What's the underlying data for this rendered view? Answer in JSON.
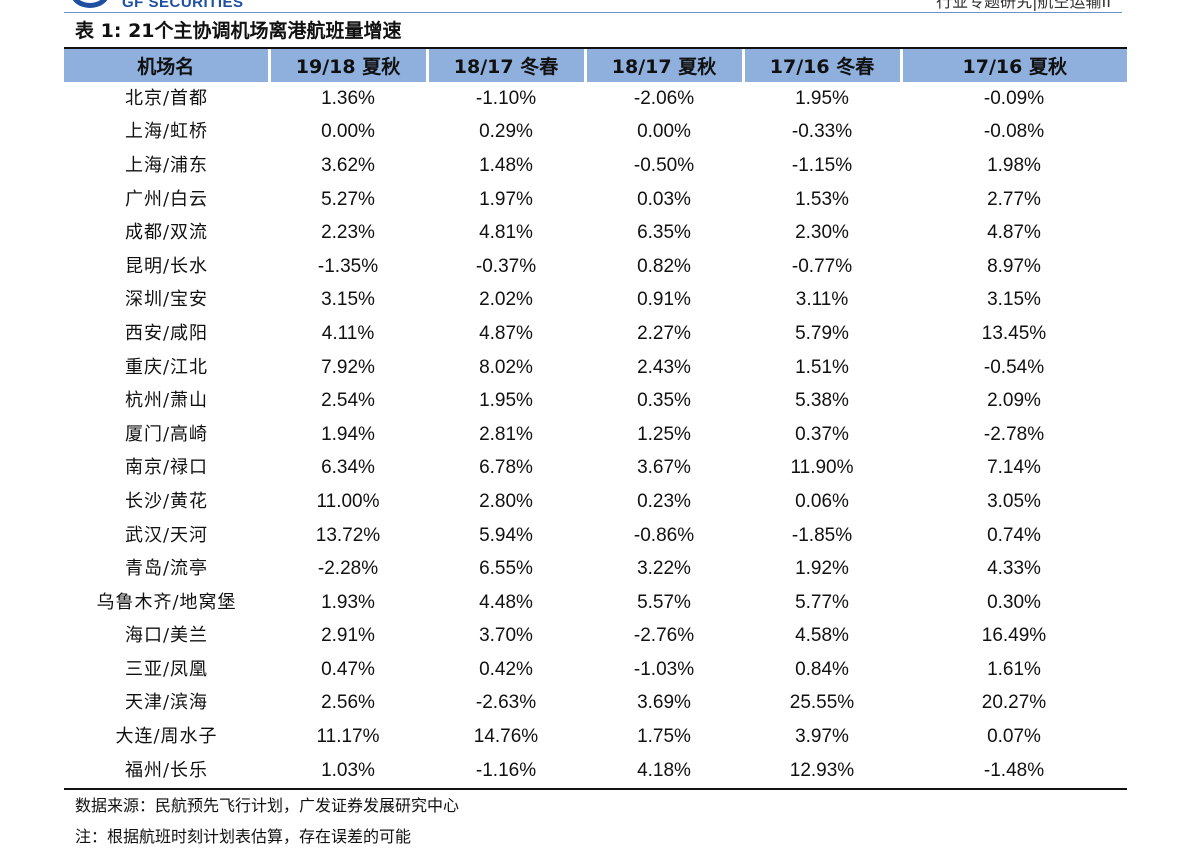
{
  "header": {
    "brand": "GF SECURITIES",
    "report_tag": "行业专题研究|航空运输II"
  },
  "table": {
    "title_prefix": "表 1:",
    "title_text": "21个主协调机场离港航班量增速",
    "columns": [
      "机场名",
      "19/18 夏秋",
      "18/17 冬春",
      "18/17 夏秋",
      "17/16 冬春",
      "17/16 夏秋"
    ],
    "rows": [
      [
        "北京/首都",
        "1.36%",
        "-1.10%",
        "-2.06%",
        "1.95%",
        "-0.09%"
      ],
      [
        "上海/虹桥",
        "0.00%",
        "0.29%",
        "0.00%",
        "-0.33%",
        "-0.08%"
      ],
      [
        "上海/浦东",
        "3.62%",
        "1.48%",
        "-0.50%",
        "-1.15%",
        "1.98%"
      ],
      [
        "广州/白云",
        "5.27%",
        "1.97%",
        "0.03%",
        "1.53%",
        "2.77%"
      ],
      [
        "成都/双流",
        "2.23%",
        "4.81%",
        "6.35%",
        "2.30%",
        "4.87%"
      ],
      [
        "昆明/长水",
        "-1.35%",
        "-0.37%",
        "0.82%",
        "-0.77%",
        "8.97%"
      ],
      [
        "深圳/宝安",
        "3.15%",
        "2.02%",
        "0.91%",
        "3.11%",
        "3.15%"
      ],
      [
        "西安/咸阳",
        "4.11%",
        "4.87%",
        "2.27%",
        "5.79%",
        "13.45%"
      ],
      [
        "重庆/江北",
        "7.92%",
        "8.02%",
        "2.43%",
        "1.51%",
        "-0.54%"
      ],
      [
        "杭州/萧山",
        "2.54%",
        "1.95%",
        "0.35%",
        "5.38%",
        "2.09%"
      ],
      [
        "厦门/高崎",
        "1.94%",
        "2.81%",
        "1.25%",
        "0.37%",
        "-2.78%"
      ],
      [
        "南京/禄口",
        "6.34%",
        "6.78%",
        "3.67%",
        "11.90%",
        "7.14%"
      ],
      [
        "长沙/黄花",
        "11.00%",
        "2.80%",
        "0.23%",
        "0.06%",
        "3.05%"
      ],
      [
        "武汉/天河",
        "13.72%",
        "5.94%",
        "-0.86%",
        "-1.85%",
        "0.74%"
      ],
      [
        "青岛/流亭",
        "-2.28%",
        "6.55%",
        "3.22%",
        "1.92%",
        "4.33%"
      ],
      [
        "乌鲁木齐/地窝堡",
        "1.93%",
        "4.48%",
        "5.57%",
        "5.77%",
        "0.30%"
      ],
      [
        "海口/美兰",
        "2.91%",
        "3.70%",
        "-2.76%",
        "4.58%",
        "16.49%"
      ],
      [
        "三亚/凤凰",
        "0.47%",
        "0.42%",
        "-1.03%",
        "0.84%",
        "1.61%"
      ],
      [
        "天津/滨海",
        "2.56%",
        "-2.63%",
        "3.69%",
        "25.55%",
        "20.27%"
      ],
      [
        "大连/周水子",
        "11.17%",
        "14.76%",
        "1.75%",
        "3.97%",
        "0.07%"
      ],
      [
        "福州/长乐",
        "1.03%",
        "-1.16%",
        "4.18%",
        "12.93%",
        "-1.48%"
      ]
    ]
  },
  "footer": {
    "source": "数据来源：民航预先飞行计划，广发证券发展研究中心",
    "note": "注：根据航班时刻计划表估算，存在误差的可能"
  },
  "colors": {
    "header_fill": "#8fb0dd",
    "brand_blue": "#1f4fa0",
    "brand_red": "#d12a2a"
  }
}
